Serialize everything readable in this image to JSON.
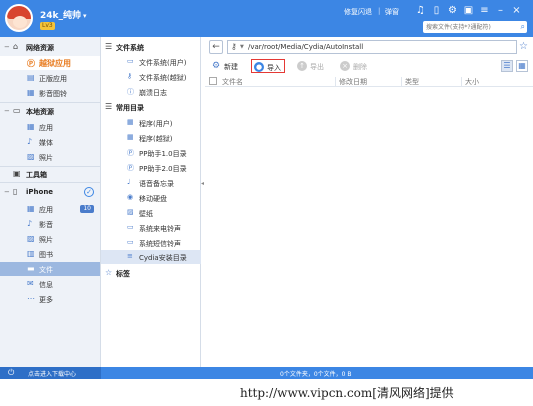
{
  "user": {
    "name": "24k_纯帅",
    "vip": "Lv3"
  },
  "titlebar": {
    "links": [
      "修复闪退",
      "弹窗"
    ],
    "search_placeholder": "搜索文件(支持*?通配符)"
  },
  "sidebar": {
    "sections": [
      {
        "label": "网络资源",
        "items": [
          {
            "label": "越狱应用",
            "icon": "app-store-icon",
            "selected": true
          },
          {
            "label": "正版应用",
            "icon": "app-icon"
          },
          {
            "label": "影音图铃",
            "icon": "media-icon"
          }
        ]
      },
      {
        "label": "本地资源",
        "items": [
          {
            "label": "应用",
            "icon": "grid-icon"
          },
          {
            "label": "媒体",
            "icon": "music-icon"
          },
          {
            "label": "照片",
            "icon": "photo-icon"
          }
        ]
      },
      {
        "label": "工具箱"
      },
      {
        "label": "iPhone",
        "items": [
          {
            "label": "应用",
            "icon": "grid-icon",
            "badge": "10"
          },
          {
            "label": "影音",
            "icon": "music-icon"
          },
          {
            "label": "照片",
            "icon": "photo-icon"
          },
          {
            "label": "图书",
            "icon": "book-icon"
          },
          {
            "label": "文件",
            "icon": "folder-icon",
            "active": true
          },
          {
            "label": "信息",
            "icon": "message-icon"
          },
          {
            "label": "更多",
            "icon": "more-icon"
          }
        ]
      }
    ]
  },
  "tree": {
    "filesystem_label": "文件系统",
    "filesystem_items": [
      "文件系统(用户)",
      "文件系统(越狱)",
      "崩溃日志"
    ],
    "common_label": "常用目录",
    "common_items": [
      "程序(用户)",
      "程序(越狱)",
      "PP助手1.0目录",
      "PP助手2.0目录",
      "语音备忘录",
      "移动硬盘",
      "壁纸",
      "系统来电铃声",
      "系统短信铃声",
      "Cydia安装目录"
    ],
    "bookmark_label": "标签"
  },
  "main": {
    "path": "/var/root/Media/Cydia/AutoInstall",
    "toolbar": {
      "new": "新建",
      "import": "导入",
      "export": "导出",
      "delete": "删除"
    },
    "columns": [
      "文件名",
      "修改日期",
      "类型",
      "大小"
    ]
  },
  "status": {
    "left": "点击进入下载中心",
    "summary": "0个文件夹，0个文件，0 B"
  },
  "footer": {
    "watermark": "http://www.vipcn.com[清风网络]提供"
  },
  "colors": {
    "accent": "#3c86e4",
    "highlight": "#e53935",
    "selected_text": "#e87b1f"
  }
}
